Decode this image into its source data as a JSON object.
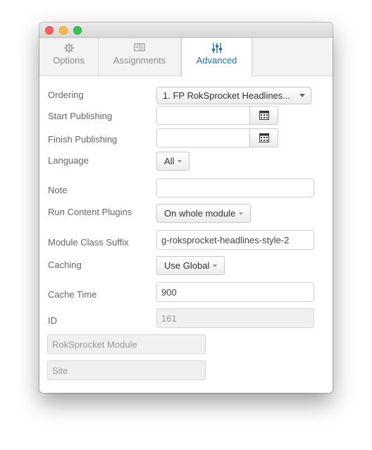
{
  "tabs": [
    {
      "label": "Options",
      "icon": "gear-icon",
      "active": false
    },
    {
      "label": "Assignments",
      "icon": "layout-icon",
      "active": false
    },
    {
      "label": "Advanced",
      "icon": "sliders-icon",
      "active": true
    }
  ],
  "form": {
    "ordering": {
      "label": "Ordering",
      "value": "1. FP RokSprocket Headlines..."
    },
    "start_publishing": {
      "label": "Start Publishing",
      "value": ""
    },
    "finish_publishing": {
      "label": "Finish Publishing",
      "value": ""
    },
    "language": {
      "label": "Language",
      "value": "All"
    },
    "note": {
      "label": "Note",
      "value": ""
    },
    "run_content_plugins": {
      "label": "Run Content Plugins",
      "value": "On whole module"
    },
    "module_class_suffix": {
      "label": "Module Class Suffix",
      "value": "g-roksprocket-headlines-style-2"
    },
    "caching": {
      "label": "Caching",
      "value": "Use Global"
    },
    "cache_time": {
      "label": "Cache Time",
      "value": "900"
    },
    "id": {
      "label": "ID",
      "value": "161"
    },
    "module_type": {
      "value": "RokSprocket Module"
    },
    "client": {
      "value": "Site"
    }
  },
  "colors": {
    "accent": "#1f6fb2",
    "close": "#fc605c",
    "minimize": "#fdbc40",
    "maximize": "#34c84a"
  }
}
